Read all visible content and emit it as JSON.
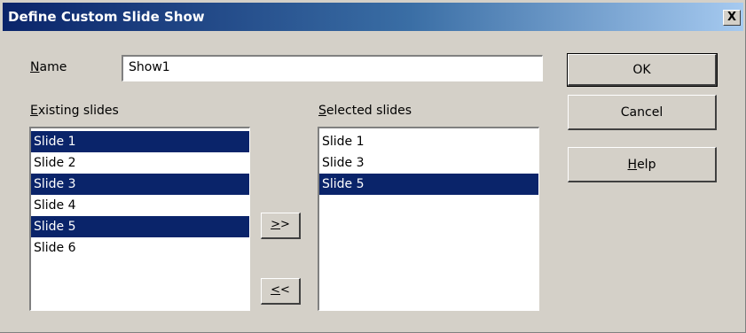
{
  "dialog": {
    "title": "Define Custom Slide Show",
    "close_label": "X"
  },
  "name_field": {
    "label_accel": "N",
    "label_rest": "ame",
    "value": "Show1"
  },
  "existing": {
    "label_accel": "E",
    "label_rest": "xisting slides",
    "items": [
      {
        "label": "Slide 1",
        "selected": true
      },
      {
        "label": "Slide 2",
        "selected": false
      },
      {
        "label": "Slide 3",
        "selected": true
      },
      {
        "label": "Slide 4",
        "selected": false
      },
      {
        "label": "Slide 5",
        "selected": true
      },
      {
        "label": "Slide 6",
        "selected": false
      }
    ]
  },
  "selected": {
    "label_accel": "S",
    "label_rest": "elected slides",
    "items": [
      {
        "label": "Slide 1",
        "selected": false
      },
      {
        "label": "Slide 3",
        "selected": false
      },
      {
        "label": "Slide 5",
        "selected": true
      }
    ]
  },
  "transfer": {
    "add_accel": ">",
    "add_rest": ">",
    "remove_accel": "<",
    "remove_rest": "<"
  },
  "buttons": {
    "ok": "OK",
    "cancel": "Cancel",
    "help_accel": "H",
    "help_rest": "elp"
  },
  "colors": {
    "dialog_bg": "#d4d0c8",
    "title_start": "#0a246a",
    "title_end": "#a6caf0",
    "selection": "#0a246a"
  }
}
